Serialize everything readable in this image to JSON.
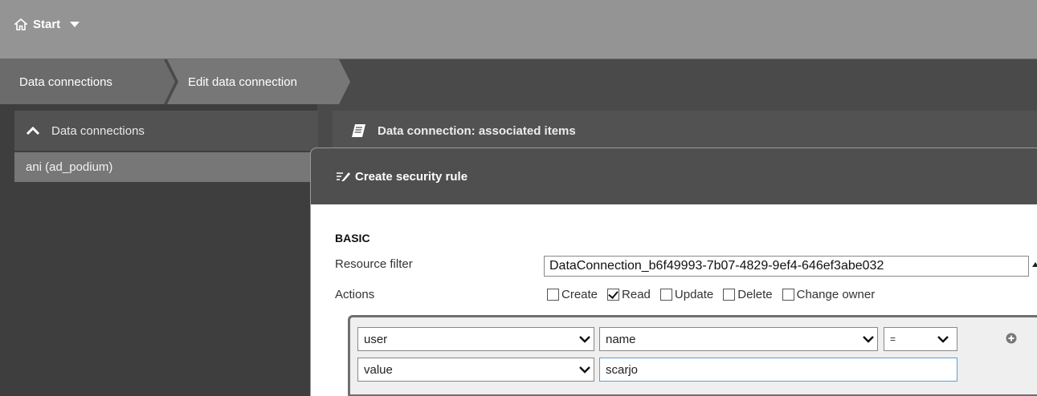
{
  "topbar": {
    "home_label": "Start"
  },
  "breadcrumb": {
    "items": [
      "Data connections",
      "Edit data connection"
    ]
  },
  "left_panel": {
    "header": "Data connections",
    "items": [
      "ani (ad_podium)"
    ]
  },
  "right_header": {
    "title": "Data connection: associated items"
  },
  "dialog": {
    "title": "Create security rule",
    "section": "BASIC",
    "resource_filter_label": "Resource filter",
    "resource_filter_value": "DataConnection_b6f49993-7b07-4829-9ef4-646ef3abe032",
    "actions_label": "Actions",
    "actions": [
      {
        "label": "Create",
        "checked": false
      },
      {
        "label": "Read",
        "checked": true
      },
      {
        "label": "Update",
        "checked": false
      },
      {
        "label": "Delete",
        "checked": false
      },
      {
        "label": "Change owner",
        "checked": false
      }
    ],
    "condition": {
      "row1": {
        "field1": "user",
        "field2": "name",
        "operator": "="
      },
      "row2": {
        "field1": "value",
        "value": "scarjo"
      }
    }
  },
  "icons": {
    "home": "home-icon",
    "dropdown": "caret-down-icon",
    "collapse": "chevron-up-icon",
    "associated": "document-scroll-icon",
    "rule": "rule-list-edit-icon",
    "add": "add-circle-icon"
  },
  "colors": {
    "topbar": "#949494",
    "dark": "#4a4a4a",
    "panel": "#525252",
    "selected": "#777777",
    "focus": "#5aa0d8"
  }
}
